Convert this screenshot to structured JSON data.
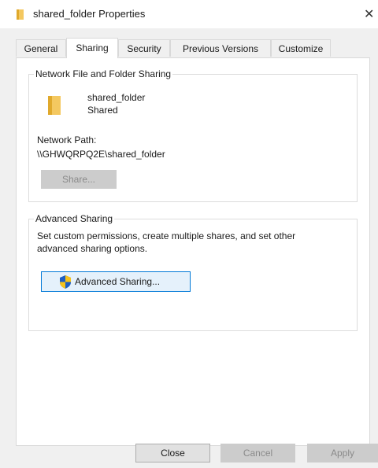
{
  "window": {
    "title": "shared_folder Properties",
    "close_glyph": "✕",
    "accent_color": "#0078d7",
    "folder_color": "#f4c860"
  },
  "tabs": [
    {
      "label": "General",
      "active": false
    },
    {
      "label": "Sharing",
      "active": true
    },
    {
      "label": "Security",
      "active": false
    },
    {
      "label": "Previous Versions",
      "active": false
    },
    {
      "label": "Customize",
      "active": false
    }
  ],
  "network_sharing": {
    "legend": "Network File and Folder Sharing",
    "folder_name": "shared_folder",
    "status": "Shared",
    "path_label": "Network Path:",
    "path_value": "\\\\GHWQRPQ2E\\shared_folder",
    "share_button": "Share..."
  },
  "advanced_sharing": {
    "legend": "Advanced Sharing",
    "description_line1": "Set custom permissions, create multiple shares, and set other",
    "description_line2": "advanced sharing options.",
    "button": "Advanced Sharing...",
    "button_icon": "uac-shield-icon"
  },
  "footer": {
    "close": "Close",
    "cancel": "Cancel",
    "apply": "Apply"
  }
}
